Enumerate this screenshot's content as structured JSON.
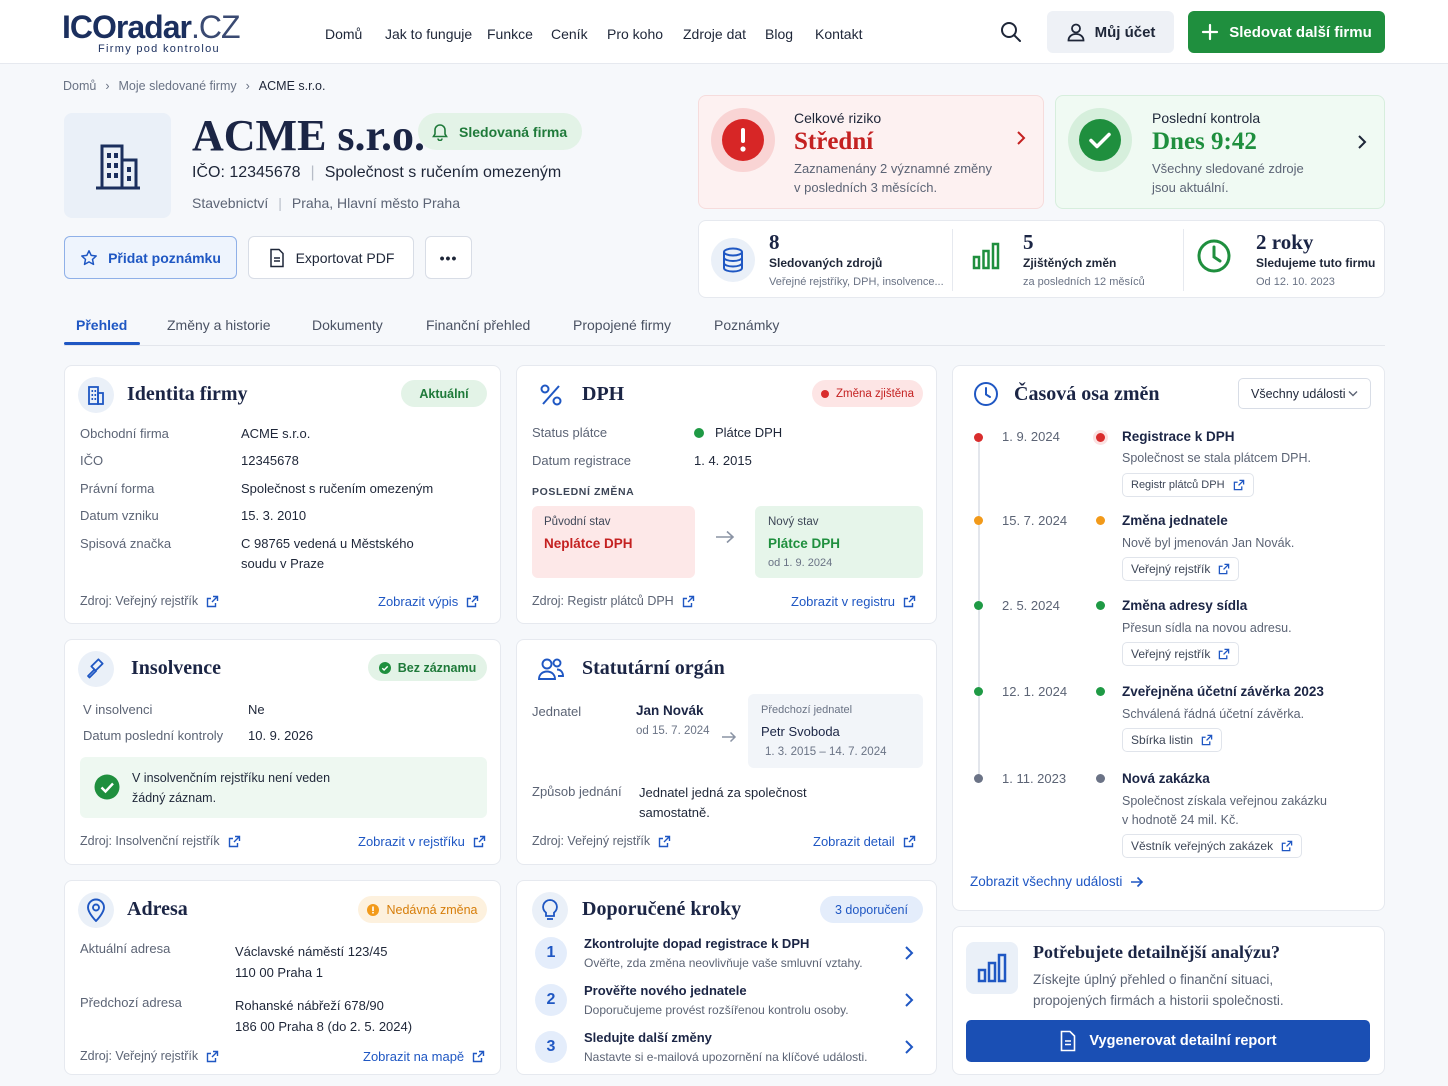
{
  "header": {
    "logo_main": "ICOradar",
    "logo_tld": ".CZ",
    "logo_tagline": "Firmy pod kontrolou",
    "nav": [
      "Domů",
      "Jak to funguje",
      "Funkce",
      "Ceník",
      "Pro koho",
      "Zdroje dat",
      "Blog",
      "Kontakt"
    ],
    "account_label": "Můj účet",
    "follow_label": "Sledovat další firmu"
  },
  "breadcrumb": [
    "Domů",
    "Moje sledované firmy",
    "ACME s.r.o."
  ],
  "company": {
    "name": "ACME s.r.o.",
    "followed_badge": "Sledovaná firma",
    "ico_line": "IČO: 12345678",
    "legal_form": "Společnost s ručením omezeným",
    "industry": "Stavebnictví",
    "location": "Praha, Hlavní město Praha"
  },
  "actions": {
    "note": "Přidat poznámku",
    "export": "Exportovat PDF",
    "more": "•••"
  },
  "risk": {
    "label": "Celkové riziko",
    "value": "Střední",
    "desc1": "Zaznamenány 2 významné změny",
    "desc2": "v posledních 3 měsících."
  },
  "last_check": {
    "label": "Poslední kontrola",
    "value": "Dnes 9:42",
    "desc1": "Všechny sledované zdroje",
    "desc2": "jsou aktuální."
  },
  "stats": [
    {
      "num": "8",
      "label": "Sledovaných zdrojů",
      "sub": "Veřejné rejstříky, DPH, insolvence..."
    },
    {
      "num": "5",
      "label": "Zjištěných změn",
      "sub": "za posledních 12 měsíců"
    },
    {
      "num": "2 roky",
      "label": "Sledujeme tuto firmu",
      "sub": "Od 12. 10. 2023"
    }
  ],
  "tabs": [
    "Přehled",
    "Změny a historie",
    "Dokumenty",
    "Finanční přehled",
    "Propojené firmy",
    "Poznámky"
  ],
  "identity": {
    "title": "Identita firmy",
    "badge": "Aktuální",
    "rows": [
      {
        "label": "Obchodní firma",
        "value": "ACME s.r.o."
      },
      {
        "label": "IČO",
        "value": "12345678"
      },
      {
        "label": "Právní forma",
        "value": "Společnost s ručením omezeným"
      },
      {
        "label": "Datum vzniku",
        "value": "15. 3. 2010"
      },
      {
        "label": "Spisová značka",
        "value": "C 98765 vedená u Městského",
        "value2": "soudu v Praze"
      }
    ],
    "source": "Zdroj: Veřejný rejstřík",
    "link": "Zobrazit výpis"
  },
  "dph": {
    "title": "DPH",
    "badge": "Změna zjištěna",
    "status_label": "Status plátce",
    "status_value": "Plátce DPH",
    "reg_label": "Datum registrace",
    "reg_value": "1. 4. 2015",
    "last_change": "POSLEDNÍ ZMĚNA",
    "old_label": "Původní stav",
    "old_value": "Neplátce DPH",
    "new_label": "Nový stav",
    "new_value": "Plátce DPH",
    "new_since": "od 1. 9. 2024",
    "source": "Zdroj: Registr plátců DPH",
    "link": "Zobrazit v registru"
  },
  "insolvency": {
    "title": "Insolvence",
    "badge": "Bez záznamu",
    "in_label": "V insolvenci",
    "in_value": "Ne",
    "check_label": "Datum poslední kontroly",
    "check_value": "10. 9. 2026",
    "note1": "V insolvenčním rejstříku není veden",
    "note2": "žádný záznam.",
    "source": "Zdroj: Insolvenční rejstřík",
    "link": "Zobrazit v rejstříku"
  },
  "statutory": {
    "title": "Statutární orgán",
    "role_label": "Jednatel",
    "current_name": "Jan Novák",
    "current_since": "od 15. 7. 2024",
    "prev_label": "Předchozí jednatel",
    "prev_name": "Petr Svoboda",
    "prev_range": "1. 3. 2015 – 14. 7. 2024",
    "method_label": "Způsob jednání",
    "method_value1": "Jednatel jedná za společnost",
    "method_value2": "samostatně.",
    "source": "Zdroj: Veřejný rejstřík",
    "link": "Zobrazit detail"
  },
  "address": {
    "title": "Adresa",
    "badge": "Nedávná změna",
    "current_label": "Aktuální adresa",
    "current_1": "Václavské náměstí 123/45",
    "current_2": "110 00 Praha 1",
    "prev_label": "Předchozí adresa",
    "prev_1": "Rohanské nábřeží 678/90",
    "prev_2": "186 00 Praha 8 (do 2. 5. 2024)",
    "source": "Zdroj: Veřejný rejstřík",
    "link": "Zobrazit na mapě"
  },
  "steps": {
    "title": "Doporučené kroky",
    "badge": "3 doporučení",
    "items": [
      {
        "n": "1",
        "title": "Zkontrolujte dopad registrace k DPH",
        "desc": "Ověřte, zda změna neovlivňuje vaše smluvní vztahy."
      },
      {
        "n": "2",
        "title": "Prověřte nového jednatele",
        "desc": "Doporučujeme provést rozšířenou kontrolu osoby."
      },
      {
        "n": "3",
        "title": "Sledujte další změny",
        "desc": "Nastavte si e-mailová upozornění na klíčové události."
      }
    ]
  },
  "timeline": {
    "title": "Časová osa změn",
    "filter": "Všechny události",
    "events": [
      {
        "date": "1. 9. 2024",
        "color": "#d92d2d",
        "title": "Registrace k DPH",
        "desc1": "Společnost se stala plátcem DPH.",
        "desc2": "",
        "chip": "Registr plátců DPH"
      },
      {
        "date": "15. 7. 2024",
        "color": "#f29a1a",
        "title": "Změna jednatele",
        "desc1": "Nově byl jmenován Jan Novák.",
        "desc2": "",
        "chip": "Veřejný rejstřík"
      },
      {
        "date": "2. 5. 2024",
        "color": "#1f9a45",
        "title": "Změna adresy sídla",
        "desc1": "Přesun sídla na novou adresu.",
        "desc2": "",
        "chip": "Veřejný rejstřík"
      },
      {
        "date": "12. 1. 2024",
        "color": "#1f9a45",
        "title": "Zveřejněna účetní závěrka 2023",
        "desc1": "Schválená řádná účetní závěrka.",
        "desc2": "",
        "chip": "Sbírka listin"
      },
      {
        "date": "1. 11. 2023",
        "color": "#6b7386",
        "title": "Nová zakázka",
        "desc1": "Společnost získala veřejnou zakázku",
        "desc2": "v hodnotě 24 mil. Kč.",
        "chip": "Věstník veřejných zakázek"
      }
    ],
    "all_link": "Zobrazit všechny události"
  },
  "analysis": {
    "title": "Potřebujete detailnější analýzu?",
    "desc1": "Získejte úplný přehled o finanční situaci,",
    "desc2": "propojených firmách a historii společnosti.",
    "button": "Vygenerovat detailní report"
  }
}
